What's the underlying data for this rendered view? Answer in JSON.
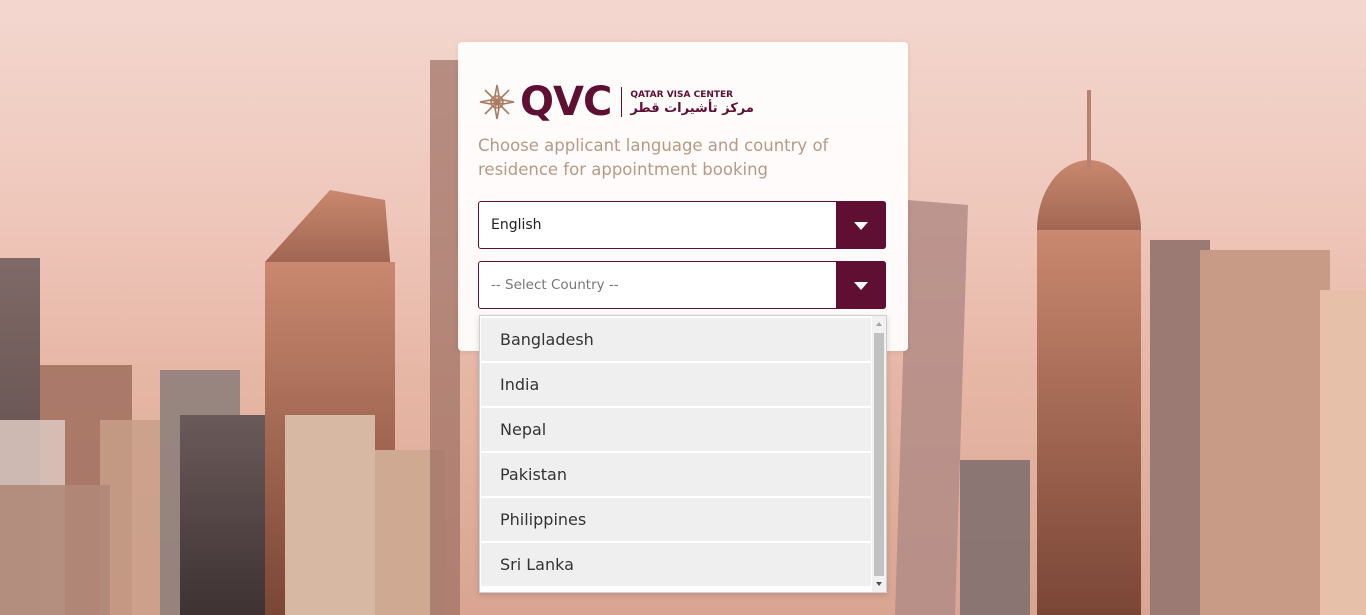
{
  "brand": {
    "logo_text": "QVC",
    "name_en": "QATAR VISA CENTER",
    "name_ar": "مركز تأشيرات قطر",
    "color": "#5f0f32",
    "logo_icon": "star-emblem-icon"
  },
  "instruction": "Choose applicant language and country of residence for appointment booking",
  "language_select": {
    "value": "English",
    "icon": "caret-down-icon"
  },
  "country_select": {
    "placeholder": "-- Select Country --",
    "icon": "caret-down-icon"
  },
  "country_options": [
    "Bangladesh",
    "India",
    "Nepal",
    "Pakistan",
    "Philippines",
    "Sri Lanka"
  ]
}
